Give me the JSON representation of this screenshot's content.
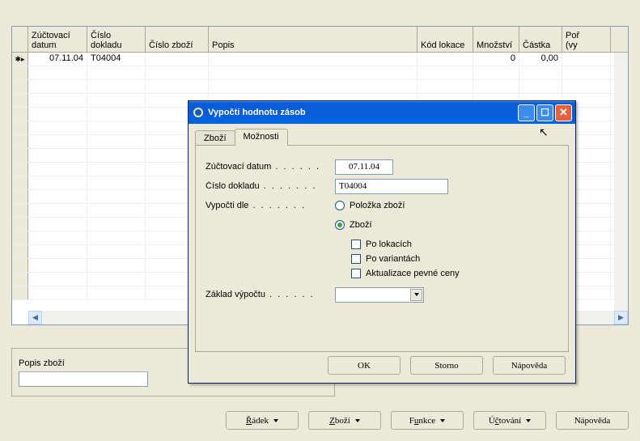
{
  "grid": {
    "columns": {
      "c1": "Zúčtovací\ndatum",
      "c2": "Číslo\ndokladu",
      "c3": "Číslo zboží",
      "c4": "Popis",
      "c5": "Kód lokace",
      "c6": "Množství",
      "c7": "Částka",
      "c8": "Poř\n(vy"
    },
    "row1": {
      "c1": "07.11.04",
      "c2": "T04004",
      "c3": "",
      "c4": "",
      "c5": "",
      "c6": "0",
      "c7": "0,00",
      "c8": ""
    }
  },
  "bottom": {
    "label": "Popis zboží",
    "btn_radek": "Řádek",
    "btn_zbozi": "Zboží",
    "btn_funkce": "Funkce",
    "btn_uctovani": "Účtování",
    "btn_napoveda": "Nápověda"
  },
  "dialog": {
    "title": "Vypočti hodnotu zásob",
    "tabs": {
      "zbozi": "Zboží",
      "moznosti": "Možnosti"
    },
    "fields": {
      "datum_label": "Zúčtovací datum",
      "datum_value": "07.11.04",
      "doklad_label": "Číslo dokladu",
      "doklad_value": "T04004",
      "vypocti_label": "Vypočti dle",
      "radio1": "Položka zboží",
      "radio2": "Zboží",
      "check1": "Po lokacích",
      "check2": "Po variantách",
      "check3": "Aktualizace pevné ceny",
      "zaklad_label": "Základ výpočtu",
      "zaklad_value": ""
    },
    "buttons": {
      "ok": "OK",
      "storno": "Storno",
      "napoveda": "Nápověda"
    }
  }
}
